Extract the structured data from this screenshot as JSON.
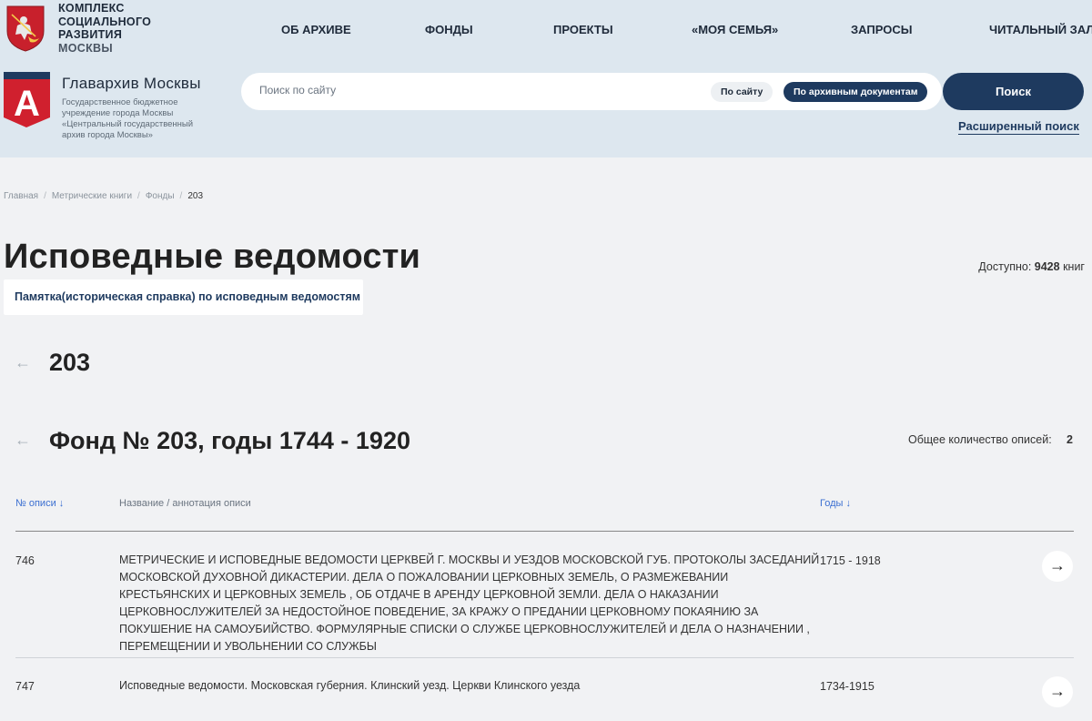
{
  "header": {
    "ksr": {
      "line1": "КОМПЛЕКС",
      "line2": "СОЦИАЛЬНОГО",
      "line3": "РАЗВИТИЯ",
      "line4": "МОСКВЫ"
    },
    "nav": [
      {
        "label": "ОБ АРХИВЕ"
      },
      {
        "label": "ФОНДЫ"
      },
      {
        "label": "ПРОЕКТЫ"
      },
      {
        "label": "«МОЯ СЕМЬЯ»"
      },
      {
        "label": "ЗАПРОСЫ"
      },
      {
        "label": "ЧИТАЛЬНЫЙ ЗАЛ"
      }
    ],
    "brand": {
      "title": "Главархив Москвы",
      "subtitle": "Государственное бюджетное учреждение города Москвы «Центральный государственный архив города Москвы»",
      "logo_letter": "А"
    },
    "search": {
      "placeholder": "Поиск по сайту",
      "scope_site": "По сайту",
      "scope_docs": "По архивным документам",
      "button": "Поиск",
      "advanced": "Расширенный поиск"
    }
  },
  "breadcrumb": {
    "items": [
      "Главная",
      "Метрические книги",
      "Фонды"
    ],
    "current": "203"
  },
  "page": {
    "title": "Исповедные ведомости",
    "available_label": "Доступно:",
    "available_value": "9428",
    "available_unit": "книг",
    "memo_link": "Памятка(историческая справка) по исповедным ведомостям",
    "back_arrow": "←",
    "section_number": "203",
    "fond_title": "Фонд № 203, годы 1744 - 1920",
    "total_label": "Общее количество описей:",
    "total_value": "2"
  },
  "table": {
    "headers": {
      "number": "№ описи ↓",
      "title": "Название / аннотация описи",
      "years": "Годы ↓"
    },
    "rows": [
      {
        "number": "746",
        "title": "МЕТРИЧЕСКИЕ И ИСПОВЕДНЫЕ ВЕДОМОСТИ ЦЕРКВЕЙ Г. МОСКВЫ И УЕЗДОВ МОСКОВСКОЙ ГУБ. ПРОТОКОЛЫ ЗАСЕДАНИЙ МОСКОВСКОЙ ДУХОВНОЙ ДИКАСТЕРИИ. ДЕЛА О ПОЖАЛОВАНИИ ЦЕРКОВНЫХ ЗЕМЕЛЬ, О РАЗМЕЖЕВАНИИ КРЕСТЬЯНСКИХ И ЦЕРКОВНЫХ ЗЕМЕЛЬ , ОБ ОТДАЧЕ В АРЕНДУ ЦЕРКОВНОЙ ЗЕМЛИ. ДЕЛА О НАКАЗАНИИ ЦЕРКОВНОСЛУЖИТЕЛЕЙ ЗА НЕДОСТОЙНОЕ ПОВЕДЕНИЕ, ЗА КРАЖУ О ПРЕДАНИИ ЦЕРКОВНОМУ ПОКАЯНИЮ ЗА ПОКУШЕНИЕ НА САМОУБИЙСТВО. ФОРМУЛЯРНЫЕ СПИСКИ О СЛУЖБЕ ЦЕРКОВНОСЛУЖИТЕЛЕЙ И ДЕЛА О НАЗНАЧЕНИИ , ПЕРЕМЕЩЕНИИ И УВОЛЬНЕНИИ СО СЛУЖБЫ",
        "years": "1715 - 1918",
        "action": "→"
      },
      {
        "number": "747",
        "title": "Исповедные ведомости. Московская губерния. Клинский уезд. Церкви Клинского уезда",
        "years": "1734-1915",
        "action": "→"
      }
    ]
  },
  "colors": {
    "header_bg": "#dde7ef",
    "page_bg": "#f1f2f4",
    "accent_dark": "#1e3a5f",
    "link_blue": "#3b6fd1",
    "logo_red": "#d0202e"
  }
}
